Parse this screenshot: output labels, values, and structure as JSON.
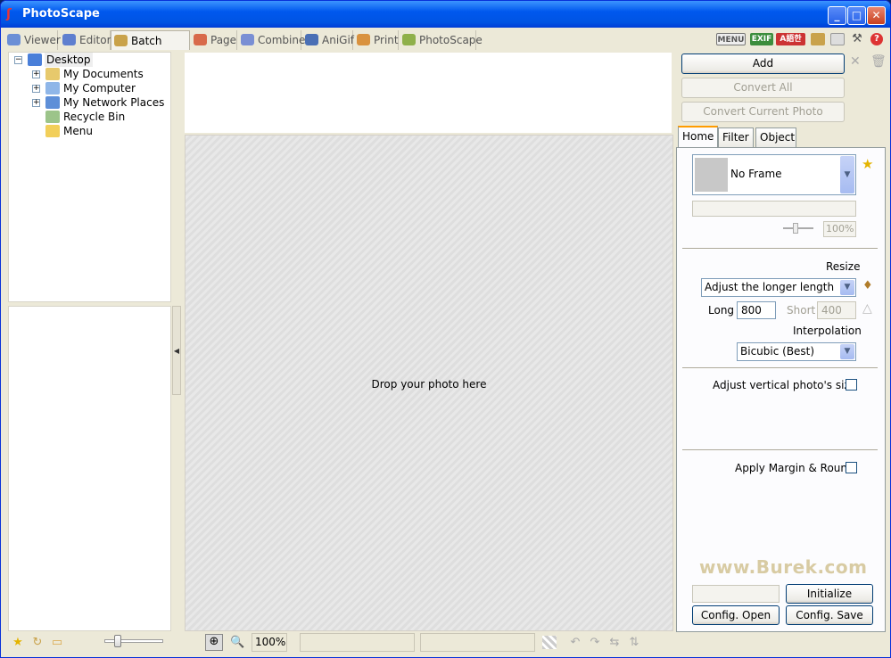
{
  "window": {
    "title": "PhotoScape"
  },
  "tabs": [
    {
      "label": "Viewer",
      "color": "#6b8fd6"
    },
    {
      "label": "Editor",
      "color": "#5f7fcf"
    },
    {
      "label": "Batch Editor",
      "color": "#c9a24b"
    },
    {
      "label": "Page",
      "color": "#d86a4a"
    },
    {
      "label": "Combine",
      "color": "#7a8fd4"
    },
    {
      "label": "AniGif",
      "color": "#4a6fb5"
    },
    {
      "label": "Print",
      "color": "#d9923f"
    },
    {
      "label": "PhotoScape",
      "color": "#8fb04a"
    }
  ],
  "top_icons": {
    "menu": "MENU",
    "exif": "EXIF",
    "lang": "A語한"
  },
  "tree": {
    "root": "Desktop",
    "items": [
      "My Documents",
      "My Computer",
      "My Network Places",
      "Recycle Bin",
      "Menu"
    ]
  },
  "drop_text": "Drop your photo here",
  "buttons": {
    "add": "Add",
    "convert_all": "Convert All",
    "convert_current": "Convert Current Photo",
    "initialize": "Initialize",
    "config_open": "Config. Open",
    "config_save": "Config. Save"
  },
  "panel_tabs": [
    "Home",
    "Filter",
    "Object"
  ],
  "frame": {
    "selected": "No Frame",
    "opacity": "100%"
  },
  "resize": {
    "label": "Resize",
    "mode": "Adjust the longer length",
    "long_label": "Long",
    "long_value": "800",
    "short_label": "Short",
    "short_value": "400",
    "interpolation_label": "Interpolation",
    "interpolation": "Bicubic (Best)"
  },
  "options": {
    "adjust_vertical": "Adjust vertical photo's size",
    "apply_margin": "Apply Margin & Round"
  },
  "watermark": "www.Burek.com",
  "status": {
    "zoom": "100%"
  }
}
